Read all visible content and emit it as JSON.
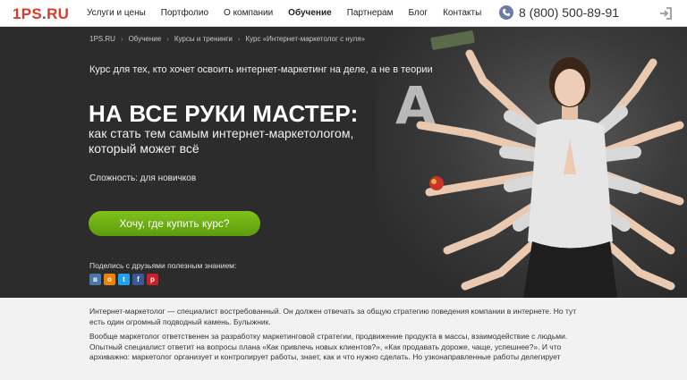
{
  "header": {
    "logo_main": "1PS",
    "logo_dot": ".",
    "logo_tld": "RU",
    "nav": [
      "Услуги и цены",
      "Портфолио",
      "О компании",
      "Обучение",
      "Партнерам",
      "Блог",
      "Контакты"
    ],
    "active_nav": "Обучение",
    "phone": "8 (800) 500-89-91"
  },
  "breadcrumb": [
    "1PS.RU",
    "Обучение",
    "Курсы и тренинги",
    "Курс «Интернет-маркетолог с нуля»"
  ],
  "hero": {
    "tagline": "Курс для тех, кто хочет освоить интернет-маркетинг на деле, а не в теории",
    "title": "НА ВСЕ РУКИ МАСТЕР:",
    "subtitle": "как стать тем самым интернет-маркетологом, который может всё",
    "difficulty": "Сложность: для новичков",
    "cta": "Хочу, где купить курс?",
    "share_label": "Поделись с друзьями полезным знанием:",
    "share_icons": [
      "vk-icon",
      "ok-icon",
      "twitter-icon",
      "facebook-icon",
      "pinterest-icon"
    ],
    "letter": "A"
  },
  "content": {
    "p1": "Интернет-маркетолог — специалист востребованный. Он должен отвечать за общую стратегию поведения компании в интернете. Но тут есть один огромный подводный камень. Булыжник.",
    "p2": "Вообще маркетолог ответственен за разработку маркетинговой стратегии, продвижение продукта в массы, взаимодействие с людьми. Опытный специалист ответит на вопросы плана «Как привлечь новых клиентов?», «Как продавать дороже, чаще, успешнее?». И что архиважно: маркетолог организует и контролирует работы, знает, как и что нужно сделать. Но узконаправленные работы делегирует"
  },
  "colors": {
    "logo_red": "#d93a2b",
    "hero_bg": "#2c2c2c",
    "cta_green": "#6fb014",
    "page_bg": "#f2f2f2"
  }
}
